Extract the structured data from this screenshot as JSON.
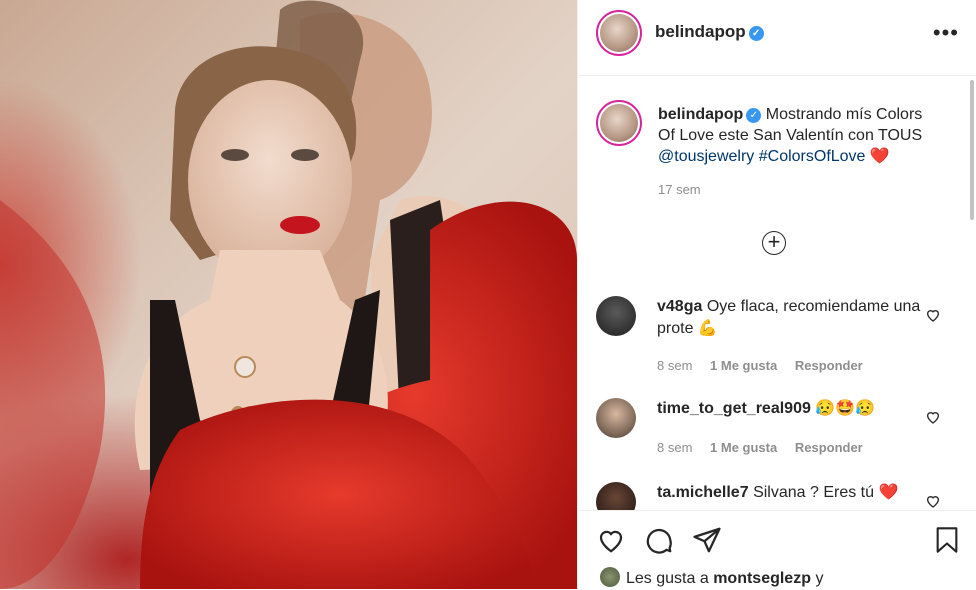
{
  "post": {
    "username": "belindapop",
    "more_label": "•••",
    "caption": {
      "username": "belindapop",
      "text": "Mostrando mís Colors Of Love este San Valentín con TOUS",
      "mention": "@tousjewelry",
      "hashtag": "#ColorsOfLove",
      "emoji": "❤️",
      "time": "17 sem"
    },
    "load_more_label": "+"
  },
  "comments": [
    {
      "username": "v48ga",
      "text": "Oye flaca, recomiendame una prote",
      "emoji": "💪",
      "time": "8 sem",
      "likes": "1 Me gusta",
      "reply": "Responder"
    },
    {
      "username": "time_to_get_real909",
      "text": "",
      "emoji": "😥🤩😥",
      "time": "8 sem",
      "likes": "1 Me gusta",
      "reply": "Responder"
    },
    {
      "username": "ta.michelle7",
      "text": "Silvana ? Eres tú",
      "emoji": "❤️"
    }
  ],
  "footer": {
    "likes_prefix": "Les gusta a",
    "likes_user": "montseglezp",
    "likes_suffix": "y"
  },
  "colors": {
    "accent_link": "#00376b",
    "verified": "#3897f0",
    "heart": "#ed4956"
  }
}
